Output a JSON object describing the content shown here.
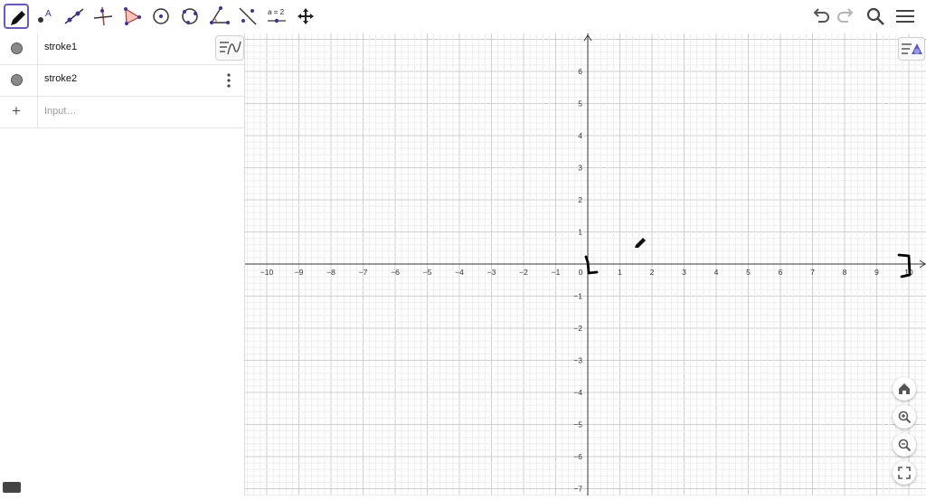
{
  "toolbar": {
    "tools": [
      {
        "name": "pen-tool",
        "active": true
      },
      {
        "name": "point-tool"
      },
      {
        "name": "line-tool"
      },
      {
        "name": "perpendicular-line-tool"
      },
      {
        "name": "polygon-tool"
      },
      {
        "name": "circle-center-point-tool"
      },
      {
        "name": "circle-three-points-tool"
      },
      {
        "name": "angle-tool"
      },
      {
        "name": "reflect-about-line-tool"
      },
      {
        "name": "slider-tool",
        "label": "a = 2"
      },
      {
        "name": "move-graphics-view-tool"
      }
    ],
    "right_buttons": [
      "undo-icon",
      "redo-icon",
      "search-icon",
      "menu-icon"
    ]
  },
  "algebra": {
    "items": [
      {
        "label": "stroke1",
        "color": "#8a8a8a"
      },
      {
        "label": "stroke2",
        "color": "#8a8a8a"
      }
    ],
    "input_placeholder": "Input…"
  },
  "graphics": {
    "x_range": [
      -10,
      10
    ],
    "y_range": [
      -7,
      6
    ],
    "grid": true,
    "x_ticks": [
      "−10",
      "−9",
      "−8",
      "−7",
      "−6",
      "−5",
      "−4",
      "−3",
      "−2",
      "−1",
      "0",
      "1",
      "2",
      "3",
      "4",
      "5",
      "6",
      "7",
      "8",
      "9",
      "10"
    ],
    "y_ticks": [
      "6",
      "5",
      "4",
      "3",
      "2",
      "1",
      "−1",
      "−2",
      "−3",
      "−4",
      "−5",
      "−6",
      "−7"
    ],
    "origin_label": "0",
    "zoom_buttons": [
      "home-icon",
      "zoom-in-icon",
      "zoom-out-icon",
      "fullscreen-icon"
    ]
  }
}
